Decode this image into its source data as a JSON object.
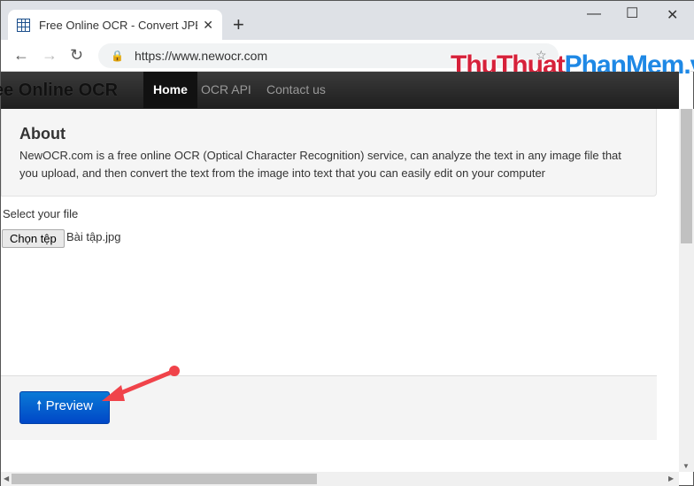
{
  "browser": {
    "tab_title": "Free Online OCR - Convert JPEG,",
    "url": "https://www.newocr.com"
  },
  "watermark": {
    "part1": "ThuThuat",
    "part2": "PhanMem.vn"
  },
  "site": {
    "brand": "ee Online OCR",
    "nav": [
      {
        "label": "Home"
      },
      {
        "label": "OCR API"
      },
      {
        "label": "Contact us"
      }
    ]
  },
  "about": {
    "title": "About",
    "text": "NewOCR.com is a free online OCR (Optical Character Recognition) service, can analyze the text in any image file that you upload, and then convert the text from the image into text that you can easily edit on your computer"
  },
  "upload": {
    "label": "Select your file",
    "button": "Chọn tệp",
    "filename": "Bài tập.jpg"
  },
  "preview": {
    "label": "Preview",
    "arrow_color": "#f0434a"
  }
}
